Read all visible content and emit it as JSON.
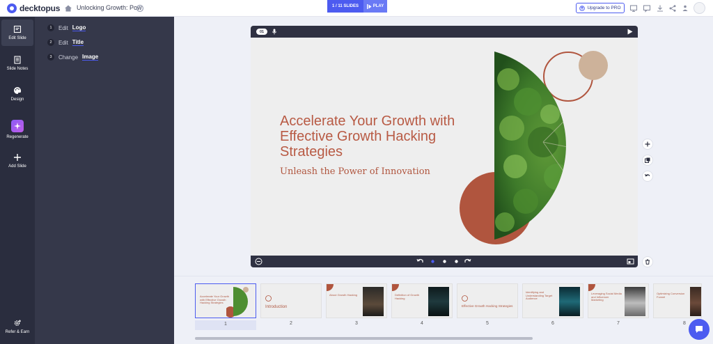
{
  "app": {
    "logo_text": "decktopus",
    "brand_color": "#4c5bf0"
  },
  "header": {
    "doc_title": "Unlocking Growth: Pow",
    "slides_count": "1 / 11 SLIDES",
    "play_label": "PLAY",
    "upgrade_label": "Upgrade to PRO"
  },
  "rail": {
    "edit_slide": "Edit Slide",
    "slide_notes": "Slide Notes",
    "design": "Design",
    "regenerate": "Regenerate",
    "add_slide": "Add Slide",
    "refer_earn": "Refer & Earn"
  },
  "steps": [
    {
      "num": "1",
      "verb": "Edit",
      "target": "Logo"
    },
    {
      "num": "2",
      "verb": "Edit",
      "target": "Title"
    },
    {
      "num": "3",
      "verb": "Change",
      "target": "Image"
    }
  ],
  "slide": {
    "number": "01",
    "title": "Accelerate Your Growth with Effective Growth Hacking Strategies",
    "subtitle": "Unleash the Power of Innovation"
  },
  "thumbnails": [
    {
      "num": "1",
      "text": "Accelerate Your Growth with Effective Growth Hacking Strategies"
    },
    {
      "num": "2",
      "text": "Introduction"
    },
    {
      "num": "3",
      "text": "About Growth Hacking"
    },
    {
      "num": "4",
      "text": "Definition of Growth Hacking"
    },
    {
      "num": "5",
      "text": "Effective Growth Hacking Strategies"
    },
    {
      "num": "6",
      "text": "Identifying and Understanding Target Audience"
    },
    {
      "num": "7",
      "text": "Leveraging Social Media and Influencer Marketing"
    },
    {
      "num": "8",
      "text": "Optimizing Conversion Funnel"
    }
  ]
}
